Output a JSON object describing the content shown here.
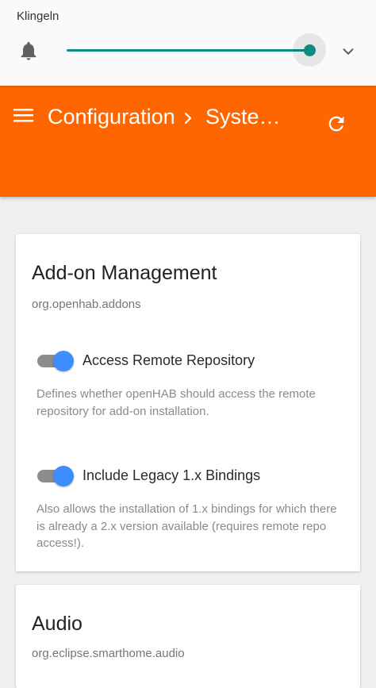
{
  "volume": {
    "title": "Klingeln",
    "level": 1.0,
    "accent": "#0d8a83"
  },
  "appbar": {
    "breadcrumb_parent": "Configuration",
    "breadcrumb_current": "Syste…",
    "color": "#ff6600"
  },
  "addon_card": {
    "title": "Add-on Management",
    "subtitle": "org.openhab.addons",
    "settings": [
      {
        "label": "Access Remote Repository",
        "enabled": true,
        "description": "Defines whether openHAB should access the remote repository for add-on installation."
      },
      {
        "label": "Include Legacy 1.x Bindings",
        "enabled": true,
        "description": "Also allows the installation of 1.x bindings for which there is already a 2.x version available (requires remote repo access!)."
      }
    ]
  },
  "audio_card": {
    "title": "Audio",
    "subtitle": "org.eclipse.smarthome.audio"
  },
  "icons": {
    "volume": "bell-icon",
    "expand": "chevron-down-icon",
    "menu": "menu-icon",
    "breadcrumb_separator": "chevron-right-icon",
    "refresh": "refresh-icon"
  }
}
